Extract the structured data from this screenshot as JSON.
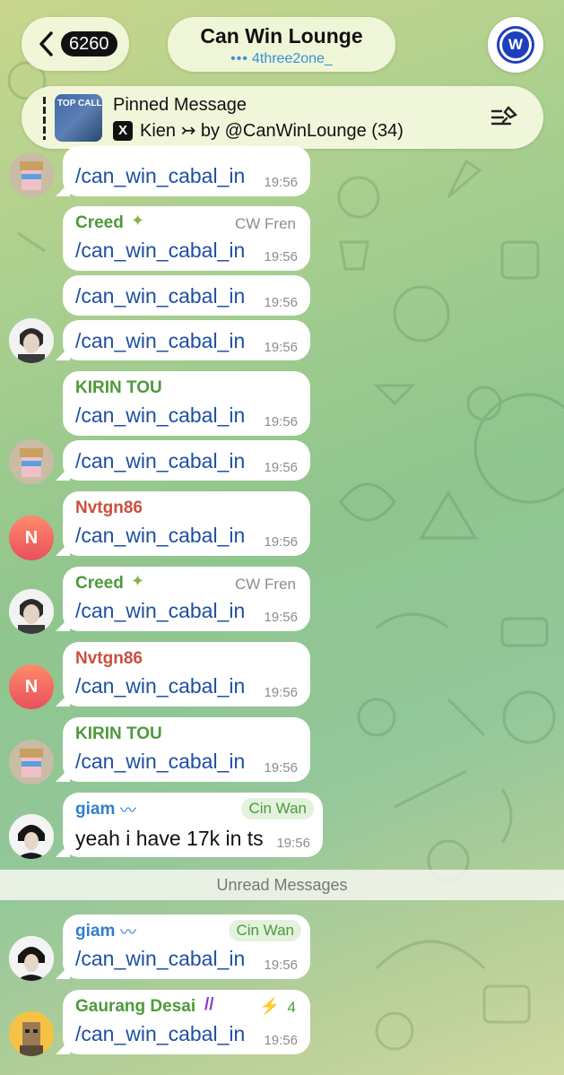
{
  "header": {
    "unread_count": "6260",
    "chat_title": "Can Win Lounge",
    "subtitle_dots": "•••",
    "subtitle": "4three2one_"
  },
  "pinned": {
    "title": "Pinned Message",
    "thumb_text": "TOP CALL",
    "preview": "Kien ↣ by @CanWinLounge (34)"
  },
  "messages": [
    {
      "sender": "",
      "role": "",
      "text": "/can_win_cabal_in",
      "time": "19:56"
    },
    {
      "sender": "Creed",
      "role": "CW Fren",
      "text": "/can_win_cabal_in",
      "time": "19:56"
    },
    {
      "sender": "",
      "role": "",
      "text": "/can_win_cabal_in",
      "time": "19:56"
    },
    {
      "sender": "",
      "role": "",
      "text": "/can_win_cabal_in",
      "time": "19:56"
    },
    {
      "sender": "KIRIN TOU",
      "role": "",
      "text": "/can_win_cabal_in",
      "time": "19:56"
    },
    {
      "sender": "",
      "role": "",
      "text": "/can_win_cabal_in",
      "time": "19:56"
    },
    {
      "sender": "Nvtgn86",
      "role": "",
      "text": "/can_win_cabal_in",
      "time": "19:56"
    },
    {
      "sender": "Creed",
      "role": "CW Fren",
      "text": "/can_win_cabal_in",
      "time": "19:56"
    },
    {
      "sender": "Nvtgn86",
      "role": "",
      "text": "/can_win_cabal_in",
      "time": "19:56"
    },
    {
      "sender": "KIRIN TOU",
      "role": "",
      "text": "/can_win_cabal_in",
      "time": "19:56"
    },
    {
      "sender": "giam",
      "role": "Cin Wan",
      "text": "yeah i have 17k in ts",
      "time": "19:56"
    },
    {
      "sender": "giam",
      "role": "Cin Wan",
      "text": "/can_win_cabal_in",
      "time": "19:56"
    },
    {
      "sender": "Gaurang Desai",
      "role": "4",
      "text": "/can_win_cabal_in",
      "time": "19:56"
    }
  ],
  "avatars": {
    "nvtgn": "N"
  },
  "unread_label": "Unread Messages",
  "colors": {
    "creed": "#4e9a3a",
    "kirin": "#4e9a3a",
    "nvtgn": "#c9503e",
    "giam": "#2f7fcf",
    "gaurang": "#4e9a3a",
    "link": "#1e4fa3"
  }
}
